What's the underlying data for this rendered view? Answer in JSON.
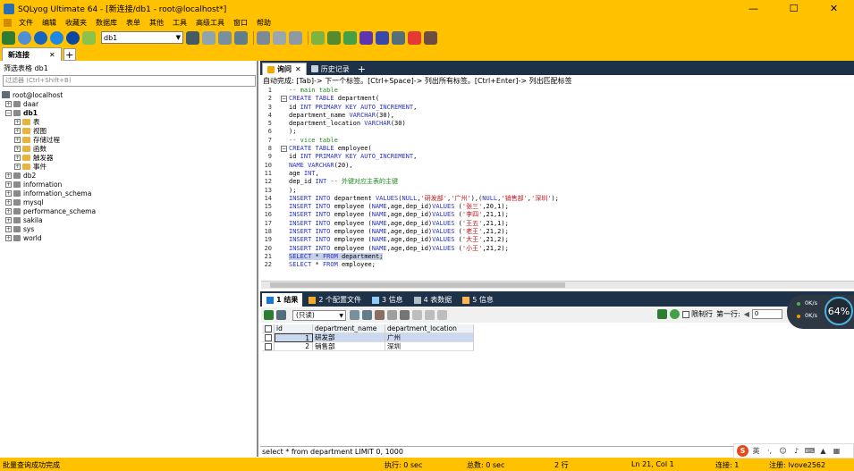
{
  "window": {
    "title": "SQLyog Ultimate 64 - [新连接/db1 - root@localhost*]",
    "controls": [
      "—",
      "☐",
      "✕"
    ]
  },
  "menu": [
    "文件",
    "编辑",
    "收藏夹",
    "数据库",
    "表单",
    "其他",
    "工具",
    "高级工具",
    "窗口",
    "帮助"
  ],
  "toolbar": {
    "db_selected": "db1"
  },
  "connection_tab": {
    "label": "新连接",
    "close": "✕",
    "add": "+"
  },
  "object_browser": {
    "filter_label": "筛选表格 db1",
    "filter_placeholder": "过滤器 (Ctrl+Shift+B)",
    "root": "root@localhost",
    "items": [
      {
        "label": "daar",
        "depth": 1,
        "kind": "db",
        "expander": "+"
      },
      {
        "label": "db1",
        "depth": 1,
        "kind": "db",
        "expander": "−",
        "bold": true
      },
      {
        "label": "表",
        "depth": 2,
        "kind": "folder",
        "expander": "+"
      },
      {
        "label": "视图",
        "depth": 2,
        "kind": "folder",
        "expander": "+"
      },
      {
        "label": "存储过程",
        "depth": 2,
        "kind": "folder",
        "expander": "+"
      },
      {
        "label": "函数",
        "depth": 2,
        "kind": "folder",
        "expander": "+"
      },
      {
        "label": "触发器",
        "depth": 2,
        "kind": "folder",
        "expander": "+"
      },
      {
        "label": "事件",
        "depth": 2,
        "kind": "folder",
        "expander": "+"
      },
      {
        "label": "db2",
        "depth": 1,
        "kind": "db",
        "expander": "+"
      },
      {
        "label": "information",
        "depth": 1,
        "kind": "db",
        "expander": "+"
      },
      {
        "label": "information_schema",
        "depth": 1,
        "kind": "db",
        "expander": "+"
      },
      {
        "label": "mysql",
        "depth": 1,
        "kind": "db",
        "expander": "+"
      },
      {
        "label": "performance_schema",
        "depth": 1,
        "kind": "db",
        "expander": "+"
      },
      {
        "label": "sakila",
        "depth": 1,
        "kind": "db",
        "expander": "+"
      },
      {
        "label": "sys",
        "depth": 1,
        "kind": "db",
        "expander": "+"
      },
      {
        "label": "world",
        "depth": 1,
        "kind": "db",
        "expander": "+"
      }
    ]
  },
  "query_tabs": [
    {
      "label": "询问",
      "active": true,
      "close": "✕"
    },
    {
      "label": "历史记录",
      "active": false
    }
  ],
  "query_tabs_add": "+",
  "autocomplete_hint": "自动完成: [Tab]-> 下一个标签。[Ctrl+Space]-> 列出所有标签。[Ctrl+Enter]-> 列出匹配标签",
  "editor": {
    "lines": [
      [
        [
          "cm",
          "-- main table"
        ]
      ],
      [
        [
          "kw",
          "CREATE TABLE"
        ],
        [
          "",
          " department("
        ]
      ],
      [
        [
          "",
          "id "
        ],
        [
          "kw",
          "INT PRIMARY KEY AUTO_INCREMENT"
        ],
        [
          "",
          ","
        ]
      ],
      [
        [
          "",
          "department_name "
        ],
        [
          "kw",
          "VARCHAR"
        ],
        [
          "",
          "(30),"
        ]
      ],
      [
        [
          "",
          "department_location "
        ],
        [
          "kw",
          "VARCHAR"
        ],
        [
          "",
          "(30)"
        ]
      ],
      [
        [
          "",
          ");"
        ]
      ],
      [
        [
          "cm",
          "-- vice table"
        ]
      ],
      [
        [
          "kw",
          "CREATE TABLE"
        ],
        [
          "",
          " employee("
        ]
      ],
      [
        [
          "",
          "id "
        ],
        [
          "kw",
          "INT PRIMARY KEY AUTO_INCREMENT"
        ],
        [
          "",
          ","
        ]
      ],
      [
        [
          "kw",
          "NAME VARCHAR"
        ],
        [
          "",
          "(20),"
        ]
      ],
      [
        [
          "",
          "age "
        ],
        [
          "kw",
          "INT"
        ],
        [
          "",
          ","
        ]
      ],
      [
        [
          "",
          "dep_id "
        ],
        [
          "kw",
          "INT"
        ],
        [
          "cm",
          " -- 外键对应主表的主键"
        ]
      ],
      [
        [
          "",
          ");"
        ]
      ],
      [
        [
          "kw",
          "INSERT INTO"
        ],
        [
          "",
          " department "
        ],
        [
          "kw",
          "VALUES"
        ],
        [
          "",
          "("
        ],
        [
          "kw",
          "NULL"
        ],
        [
          "",
          ","
        ],
        [
          "str",
          "'研发部'"
        ],
        [
          "",
          ","
        ],
        [
          "str",
          "'广州'"
        ],
        [
          "",
          "),("
        ],
        [
          "kw",
          "NULL"
        ],
        [
          "",
          ","
        ],
        [
          "str",
          "'销售部'"
        ],
        [
          "",
          ","
        ],
        [
          "str",
          "'深圳'"
        ],
        [
          "",
          ");"
        ]
      ],
      [
        [
          "kw",
          "INSERT INTO"
        ],
        [
          "",
          " employee ("
        ],
        [
          "kw",
          "NAME"
        ],
        [
          "",
          ",age,dep_id)"
        ],
        [
          "kw",
          "VALUES"
        ],
        [
          "",
          " ("
        ],
        [
          "str",
          "'张三'"
        ],
        [
          "",
          ",20,1);"
        ]
      ],
      [
        [
          "kw",
          "INSERT INTO"
        ],
        [
          "",
          " employee ("
        ],
        [
          "kw",
          "NAME"
        ],
        [
          "",
          ",age,dep_id)"
        ],
        [
          "kw",
          "VALUES"
        ],
        [
          "",
          " ("
        ],
        [
          "str",
          "'李四'"
        ],
        [
          "",
          ",21,1);"
        ]
      ],
      [
        [
          "kw",
          "INSERT INTO"
        ],
        [
          "",
          " employee ("
        ],
        [
          "kw",
          "NAME"
        ],
        [
          "",
          ",age,dep_id)"
        ],
        [
          "kw",
          "VALUES"
        ],
        [
          "",
          " ("
        ],
        [
          "str",
          "'王五'"
        ],
        [
          "",
          ",21,1);"
        ]
      ],
      [
        [
          "kw",
          "INSERT INTO"
        ],
        [
          "",
          " employee ("
        ],
        [
          "kw",
          "NAME"
        ],
        [
          "",
          ",age,dep_id)"
        ],
        [
          "kw",
          "VALUES"
        ],
        [
          "",
          " ("
        ],
        [
          "str",
          "'老王'"
        ],
        [
          "",
          ",21,2);"
        ]
      ],
      [
        [
          "kw",
          "INSERT INTO"
        ],
        [
          "",
          " employee ("
        ],
        [
          "kw",
          "NAME"
        ],
        [
          "",
          ",age,dep_id)"
        ],
        [
          "kw",
          "VALUES"
        ],
        [
          "",
          " ("
        ],
        [
          "str",
          "'大王'"
        ],
        [
          "",
          ",21,2);"
        ]
      ],
      [
        [
          "kw",
          "INSERT INTO"
        ],
        [
          "",
          " employee ("
        ],
        [
          "kw",
          "NAME"
        ],
        [
          "",
          ",age,dep_id)"
        ],
        [
          "kw",
          "VALUES"
        ],
        [
          "",
          " ("
        ],
        [
          "str",
          "'小王'"
        ],
        [
          "",
          ",21,2);"
        ]
      ],
      [
        [
          "kw",
          "SELECT"
        ],
        [
          "",
          " * "
        ],
        [
          "kw",
          "FROM"
        ],
        [
          "",
          " department;"
        ]
      ],
      [
        [
          "kw",
          "SELECT"
        ],
        [
          "",
          " * "
        ],
        [
          "kw",
          "FROM"
        ],
        [
          "",
          " employee;"
        ]
      ]
    ],
    "selected_line": 21,
    "fold_lines": [
      2,
      8
    ]
  },
  "result_tabs": [
    {
      "label": "1 结果",
      "active": true
    },
    {
      "label": "2 个配置文件",
      "active": false
    },
    {
      "label": "3 信息",
      "active": false
    },
    {
      "label": "4 表数据",
      "active": false
    },
    {
      "label": "5 信息",
      "active": false
    }
  ],
  "result_toolbar": {
    "mode": "(只读)",
    "limit_label": "限制行",
    "first_row_label": "第一行:",
    "first_row_value": "0"
  },
  "result_grid": {
    "columns": [
      "id",
      "department_name",
      "department_location"
    ],
    "rows": [
      [
        "1",
        "研发部",
        "广州"
      ],
      [
        "2",
        "销售部",
        "深圳"
      ]
    ]
  },
  "sql_status": "select * from department LIMIT 0, 1000",
  "statusbar": {
    "message": "批量查询成功完成",
    "exec": "执行: 0 sec",
    "total": "总数: 0 sec",
    "rows": "2 行",
    "position": "Ln 21, Col 1",
    "connections": "连接: 1",
    "user": "注册: lvove2562"
  },
  "net_widget": {
    "up": "0K/s",
    "down": "0K/s",
    "percent": "64%"
  },
  "ime": {
    "logo": "S",
    "mode": "英"
  }
}
